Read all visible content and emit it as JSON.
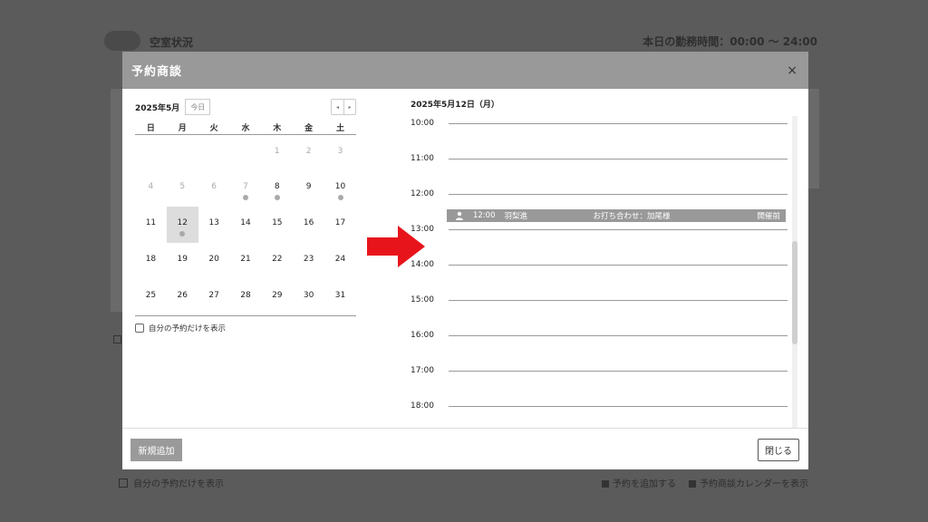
{
  "background": {
    "app_title": "空室状況",
    "work_hours": "本日の勤務時間：00:00 〜 24:00",
    "footer_checkbox_label": "自分の予約だけを表示",
    "footer_link_add": "予約を追加する",
    "footer_link_calendar": "予約商談カレンダーを表示"
  },
  "modal": {
    "title": "予約商談",
    "close_icon": "×",
    "calendar": {
      "month_label": "2025年5月",
      "today_label": "今日",
      "prev_icon": "◂",
      "next_icon": "▸",
      "weekdays": [
        "日",
        "月",
        "火",
        "水",
        "木",
        "金",
        "土"
      ],
      "weeks": [
        [
          {
            "d": ""
          },
          {
            "d": ""
          },
          {
            "d": ""
          },
          {
            "d": ""
          },
          {
            "d": "1",
            "other": true
          },
          {
            "d": "2",
            "other": true
          },
          {
            "d": "3",
            "other": true
          }
        ],
        [
          {
            "d": "4",
            "other": true
          },
          {
            "d": "5",
            "other": true
          },
          {
            "d": "6",
            "other": true
          },
          {
            "d": "7",
            "other": true,
            "dot": true
          },
          {
            "d": "8",
            "dot": true
          },
          {
            "d": "9"
          },
          {
            "d": "10",
            "dot": true
          }
        ],
        [
          {
            "d": "11"
          },
          {
            "d": "12",
            "selected": true,
            "dot": true
          },
          {
            "d": "13"
          },
          {
            "d": "14"
          },
          {
            "d": "15"
          },
          {
            "d": "16"
          },
          {
            "d": "17"
          }
        ],
        [
          {
            "d": "18"
          },
          {
            "d": "19"
          },
          {
            "d": "20"
          },
          {
            "d": "21"
          },
          {
            "d": "22"
          },
          {
            "d": "23"
          },
          {
            "d": "24"
          }
        ],
        [
          {
            "d": "25"
          },
          {
            "d": "26"
          },
          {
            "d": "27"
          },
          {
            "d": "28"
          },
          {
            "d": "29"
          },
          {
            "d": "30"
          },
          {
            "d": "31"
          }
        ]
      ],
      "own_only_label": "自分の予約だけを表示"
    },
    "day_view": {
      "date_label": "2025年5月12日（月）",
      "hours": [
        "10:00",
        "11:00",
        "12:00",
        "13:00",
        "14:00",
        "15:00",
        "16:00",
        "17:00",
        "18:00"
      ],
      "event": {
        "icon": "person-icon",
        "time": "12:00",
        "name": "羽梨進",
        "subject": "お打ち合わせ：加尾様",
        "status": "開催前"
      }
    },
    "footer": {
      "add_label": "新規追加",
      "close_label": "閉じる"
    }
  },
  "colors": {
    "overlay": "#5b5b5b",
    "header": "#999999",
    "event": "#999999",
    "arrow": "#e8141b",
    "selected_day": "#dddddd"
  }
}
